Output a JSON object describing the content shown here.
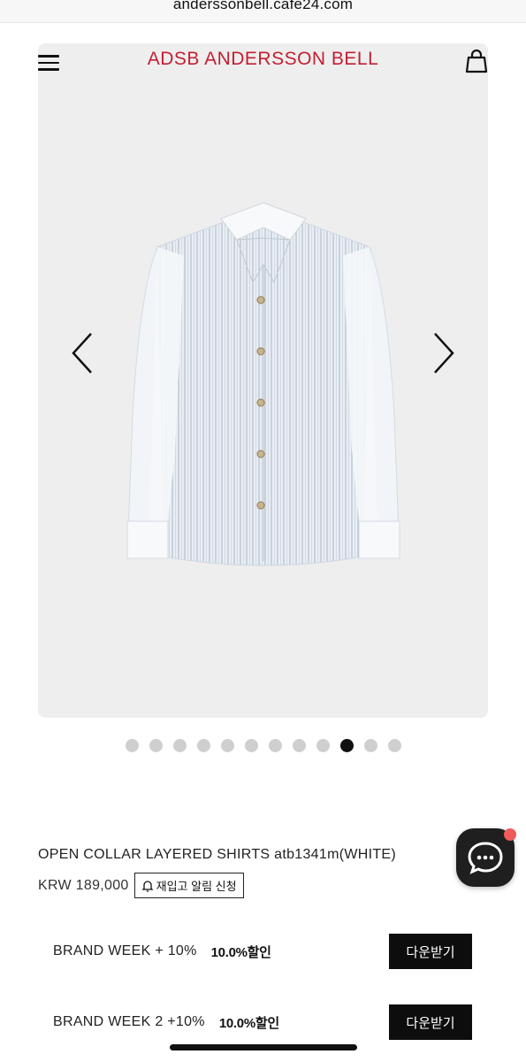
{
  "browser": {
    "url": "anderssonbell.cafe24.com"
  },
  "header": {
    "brand": "ADSB  ANDERSSON BELL",
    "brand_color": "#c21f32"
  },
  "icons": {
    "menu": "hamburger-menu-icon",
    "bag": "shopping-bag-icon",
    "prev": "chevron-left-icon",
    "next": "chevron-right-icon",
    "chat": "chat-bubble-icon",
    "bell": "bell-icon"
  },
  "gallery": {
    "total_slides": 12,
    "active_slide": 10
  },
  "product": {
    "title": "OPEN COLLAR LAYERED SHIRTS atb1341m(WHITE)",
    "price": "KRW 189,000",
    "restock_label": "재입고 알림 신청"
  },
  "coupons": [
    {
      "name": "BRAND WEEK + 10%",
      "rate": "10.0%할인",
      "button": "다운받기"
    },
    {
      "name": "BRAND WEEK 2 +10%",
      "rate": "10.0%할인",
      "button": "다운받기"
    }
  ],
  "colors": {
    "accent": "#c21f32",
    "chat_badge": "#f05a5a",
    "button_bg": "#0d0d0d"
  }
}
